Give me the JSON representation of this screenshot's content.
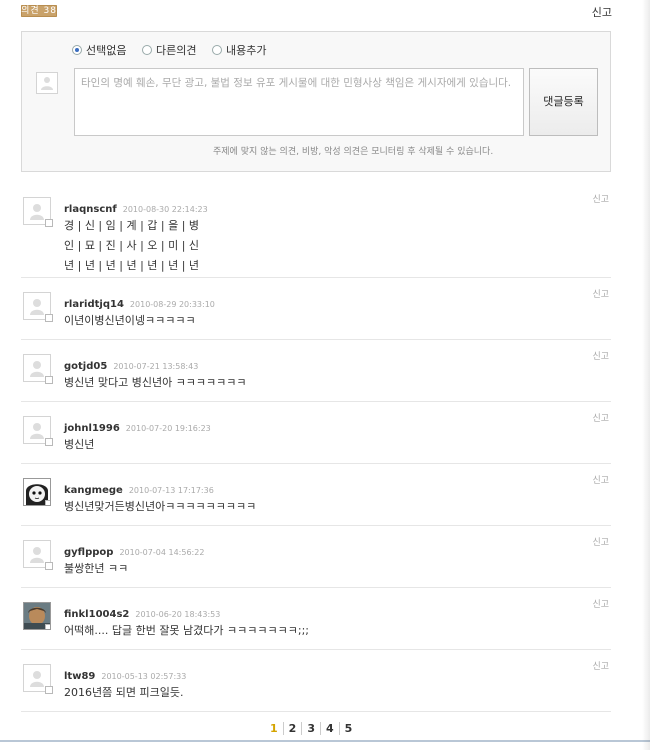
{
  "header": {
    "badge_label": "의견 38",
    "report_label": "신고"
  },
  "write": {
    "radios": [
      {
        "label": "선택없음",
        "checked": true
      },
      {
        "label": "다른의견",
        "checked": false
      },
      {
        "label": "내용추가",
        "checked": false
      }
    ],
    "placeholder": "타인의 명예 훼손, 무단 광고, 불법 정보 유포 게시물에 대한 민형사상 책임은 게시자에게 있습니다.",
    "submit_label": "댓글등록",
    "notice": "주제에 맞지 않는 의견, 비방, 악성 의견은 모니터링 후 삭제될 수 있습니다."
  },
  "comments": [
    {
      "user": "rlaqnscnf",
      "date": "2010-08-30 22:14:23",
      "text": "경 | 신 | 임 | 계 | 갑 | 을 | 병\n인 | 묘 | 진 | 사 | 오 | 미 | 신\n년 | 년 | 년 | 년 | 년 | 년 | 년",
      "report": "신고",
      "avatar": "default"
    },
    {
      "user": "rlaridtjq14",
      "date": "2010-08-29 20:33:10",
      "text": "이년이병신년이넹ㅋㅋㅋㅋㅋ",
      "report": "신고",
      "avatar": "default"
    },
    {
      "user": "gotjd05",
      "date": "2010-07-21 13:58:43",
      "text": "병신년 맞다고 병신년아 ㅋㅋㅋㅋㅋㅋㅋ",
      "report": "신고",
      "avatar": "default"
    },
    {
      "user": "johnl1996",
      "date": "2010-07-20 19:16:23",
      "text": "병신년",
      "report": "신고",
      "avatar": "default"
    },
    {
      "user": "kangmege",
      "date": "2010-07-13 17:17:36",
      "text": "병신년맞거든병신년아ㅋㅋㅋㅋㅋㅋㅋㅋㅋ",
      "report": "신고",
      "avatar": "cartoon"
    },
    {
      "user": "gyflppop",
      "date": "2010-07-04 14:56:22",
      "text": "불쌍한년 ㅋㅋ",
      "report": "신고",
      "avatar": "default"
    },
    {
      "user": "finkl1004s2",
      "date": "2010-06-20 18:43:53",
      "text": "어떡해.... 답글 한번 잘못 남겼다가 ㅋㅋㅋㅋㅋㅋㅋ;;;",
      "report": "신고",
      "avatar": "photo"
    },
    {
      "user": "ltw89",
      "date": "2010-05-13 02:57:33",
      "text": "2016년쯤 되면 피크일듯.",
      "report": "신고",
      "avatar": "default"
    }
  ],
  "pagination": {
    "pages": [
      "1",
      "2",
      "3",
      "4",
      "5"
    ],
    "current": "1"
  },
  "colors": {
    "badge": "#c9a26a",
    "active_page": "#d4a400"
  }
}
